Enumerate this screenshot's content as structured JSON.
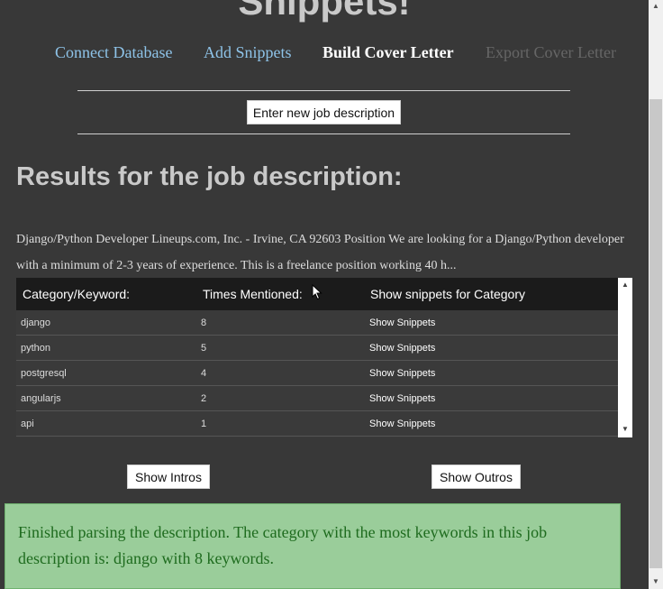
{
  "app": {
    "title": "Snippets!"
  },
  "nav": {
    "connect_database": "Connect Database",
    "add_snippets": "Add Snippets",
    "build_cover_letter": "Build Cover Letter",
    "export_cover_letter": "Export Cover Letter"
  },
  "actions": {
    "enter_new_job_description": "Enter new job description"
  },
  "results": {
    "heading": "Results for the job description:",
    "job_description": "Django/Python Developer Lineups.com, Inc. - Irvine, CA 92603 Position We are looking for a Django/Python developer with a minimum of 2-3 years of experience. This is a freelance position working 40 h..."
  },
  "table": {
    "headers": [
      "Category/Keyword:",
      "Times Mentioned:",
      "Show snippets for Category"
    ],
    "rows": [
      {
        "keyword": "django",
        "count": "8",
        "action": "Show Snippets"
      },
      {
        "keyword": "python",
        "count": "5",
        "action": "Show Snippets"
      },
      {
        "keyword": "postgresql",
        "count": "4",
        "action": "Show Snippets"
      },
      {
        "keyword": "angularjs",
        "count": "2",
        "action": "Show Snippets"
      },
      {
        "keyword": "api",
        "count": "1",
        "action": "Show Snippets"
      }
    ]
  },
  "buttons": {
    "show_intros": "Show Intros",
    "show_outros": "Show Outros"
  },
  "alert": {
    "message": "Finished parsing the description. The category with the most keywords in this job description is: django with 8 keywords."
  },
  "colors": {
    "background": "#383838",
    "nav_link": "#8ec3e8",
    "nav_disabled": "#666666",
    "table_header": "#1b1b1b",
    "alert_bg": "#9acd9a",
    "alert_text": "#1e6b1e"
  },
  "icons": {
    "table_scroll_up": "triangle-up-icon",
    "table_scroll_down": "triangle-down-icon",
    "cursor": "mouse-pointer-icon"
  }
}
